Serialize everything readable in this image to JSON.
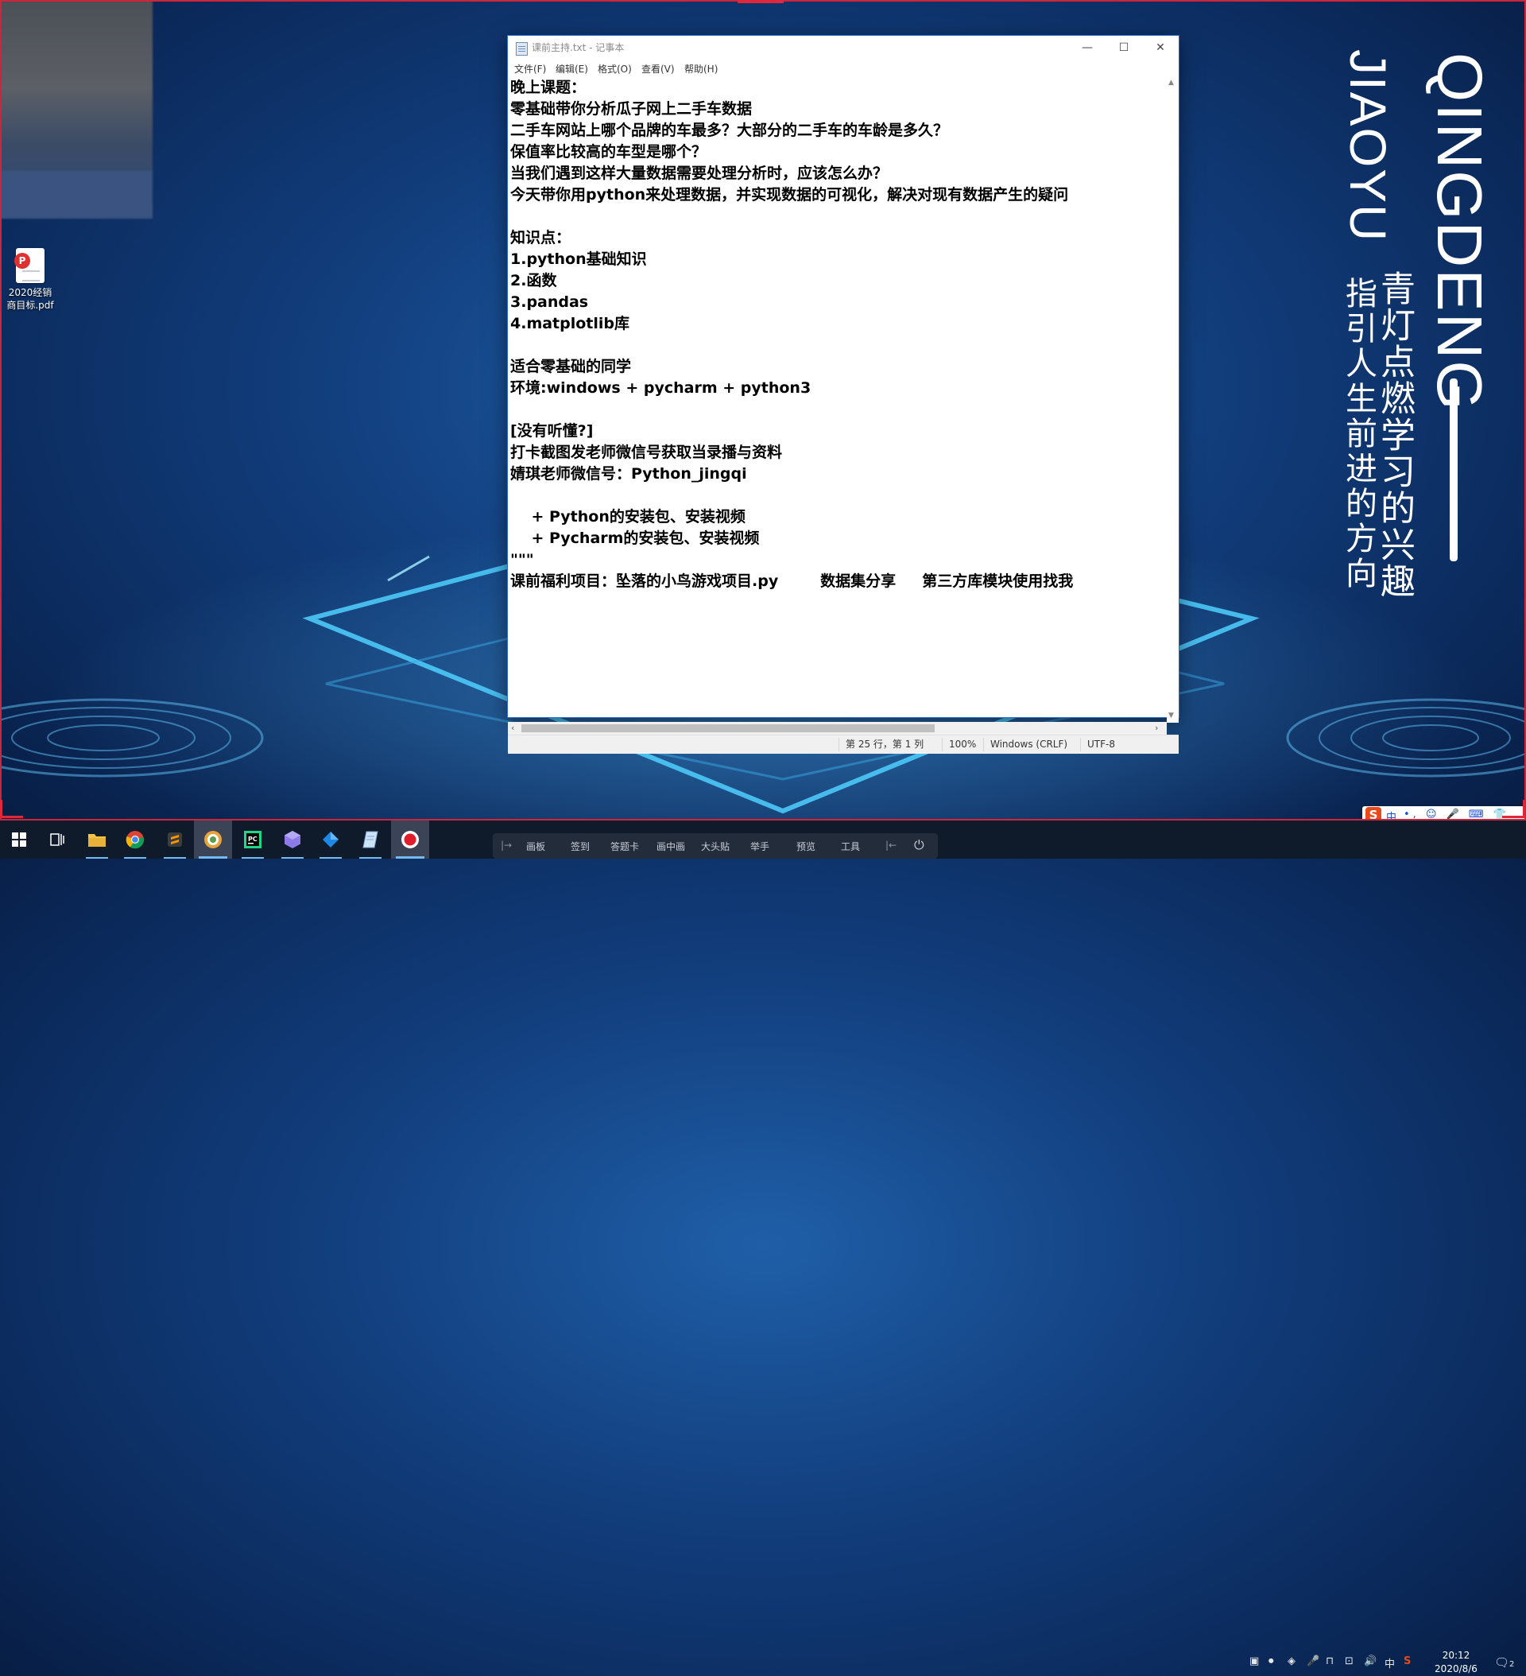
{
  "window": {
    "title": "课前主持.txt - 记事本",
    "controls": {
      "minimize": "—",
      "maximize": "☐",
      "close": "✕"
    },
    "menu": [
      "文件(F)",
      "编辑(E)",
      "格式(O)",
      "查看(V)",
      "帮助(H)"
    ],
    "content": "晚上课题：\n零基础带你分析瓜子网上二手车数据\n二手车网站上哪个品牌的车最多？大部分的二手车的车龄是多久？\n保值率比较高的车型是哪个？\n当我们遇到这样大量数据需要处理分析时，应该怎么办？\n今天带你用python来处理数据，并实现数据的可视化，解决对现有数据产生的疑问\n\n知识点：\n1.python基础知识\n2.函数\n3.pandas\n4.matplotlib库\n\n适合零基础的同学\n环境:windows + pycharm + python3\n\n[没有听懂?]\n打卡截图发老师微信号获取当录播与资料\n婧琪老师微信号：Python_jingqi\n\n    + Python的安装包、安装视频\n    + Pycharm的安装包、安装视频\n\"\"\"\n课前福利项目：坠落的小鸟游戏项目.py        数据集分享     第三方库模块使用找我",
    "status": {
      "position": "第 25 行，第 1 列",
      "zoom": "100%",
      "line_ending": "Windows (CRLF)",
      "encoding": "UTF-8"
    }
  },
  "desktop": {
    "icon_label": "2020经销商目标.pdf",
    "pdf_badge": "P",
    "slogan_en_1": "QINGDENG",
    "slogan_en_2": "JIAOYU",
    "slogan_cn_1": "青灯点燃学习的兴趣",
    "slogan_cn_2": "指引人生前进的方向"
  },
  "recorder_toolbar": [
    "画板",
    "签到",
    "答题卡",
    "画中画",
    "大头贴",
    "举手",
    "预览",
    "工具"
  ],
  "ime": {
    "mode": "中",
    "glyphs": "•, ☺ 🎤 ⌨ 👕"
  },
  "tray": {
    "lang": "中"
  },
  "clock": {
    "time": "20:12",
    "date": "2020/8/6"
  },
  "notifications": {
    "count": "2"
  }
}
